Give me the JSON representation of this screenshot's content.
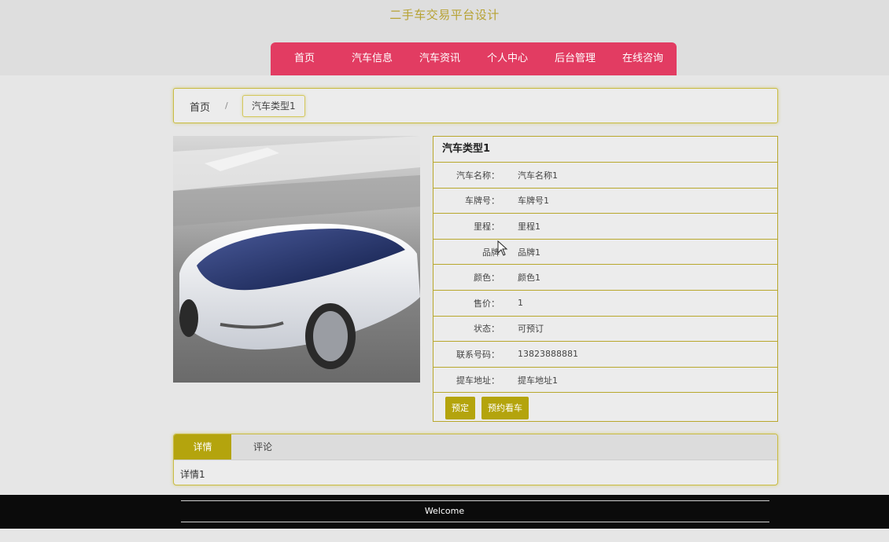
{
  "header": {
    "site_title": "二手车交易平台设计",
    "nav": [
      "首页",
      "汽车信息",
      "汽车资讯",
      "个人中心",
      "后台管理",
      "在线咨询"
    ]
  },
  "breadcrumb": {
    "home": "首页",
    "separator": "/",
    "current": "汽车类型1"
  },
  "detail": {
    "title": "汽车类型1",
    "rows": [
      {
        "label": "汽车名称：",
        "value": "汽车名称1"
      },
      {
        "label": "车牌号：",
        "value": "车牌号1"
      },
      {
        "label": "里程：",
        "value": "里程1"
      },
      {
        "label": "品牌",
        "value": "品牌1"
      },
      {
        "label": "颜色：",
        "value": "颜色1"
      },
      {
        "label": "售价：",
        "value": "1"
      },
      {
        "label": "状态：",
        "value": "可预订"
      },
      {
        "label": "联系号码：",
        "value": "13823888881"
      },
      {
        "label": "提车地址：",
        "value": "提车地址1"
      }
    ],
    "buttons": {
      "reserve": "预定",
      "viewing": "预约看车"
    }
  },
  "tabs": {
    "details": "详情",
    "comments": "评论",
    "content": "详情1"
  },
  "footer": {
    "text": "Welcome"
  },
  "colors": {
    "nav_bg": "#e23c62",
    "accent": "#b4a40d",
    "title": "#b7a233"
  }
}
